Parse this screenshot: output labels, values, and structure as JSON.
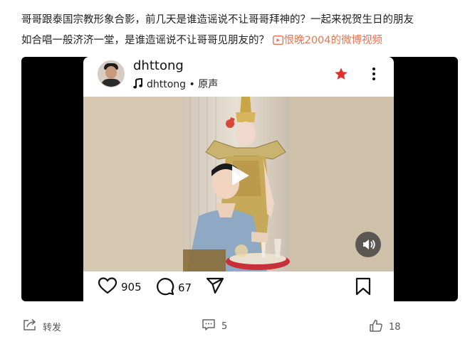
{
  "post": {
    "line1": "哥哥跟泰国宗教形象合影，前几天是谁造谣说不让哥哥拜神的？一起来祝贺生日的朋友",
    "line2": "如合唱一般济济一堂，是谁造谣说不让哥哥见朋友的？",
    "video_link": "恨晚2004的微博视频"
  },
  "embed": {
    "username": "dhttong",
    "audio_user": "dhttong",
    "audio_separator": " • ",
    "audio_label": "原声",
    "likes": "905",
    "comments": "67"
  },
  "footer": {
    "repost_label": "转发",
    "comment_count": "5",
    "like_count": "18"
  },
  "colors": {
    "link": "#eb7350",
    "star": "#e0302a",
    "frame": "#000000"
  },
  "icons": [
    "video-icon",
    "music-note-icon",
    "star-icon",
    "more-icon",
    "play-icon",
    "sound-icon",
    "heart-icon",
    "comment-icon",
    "share-icon",
    "bookmark-icon",
    "repost-icon",
    "comment-footer-icon",
    "like-icon"
  ]
}
